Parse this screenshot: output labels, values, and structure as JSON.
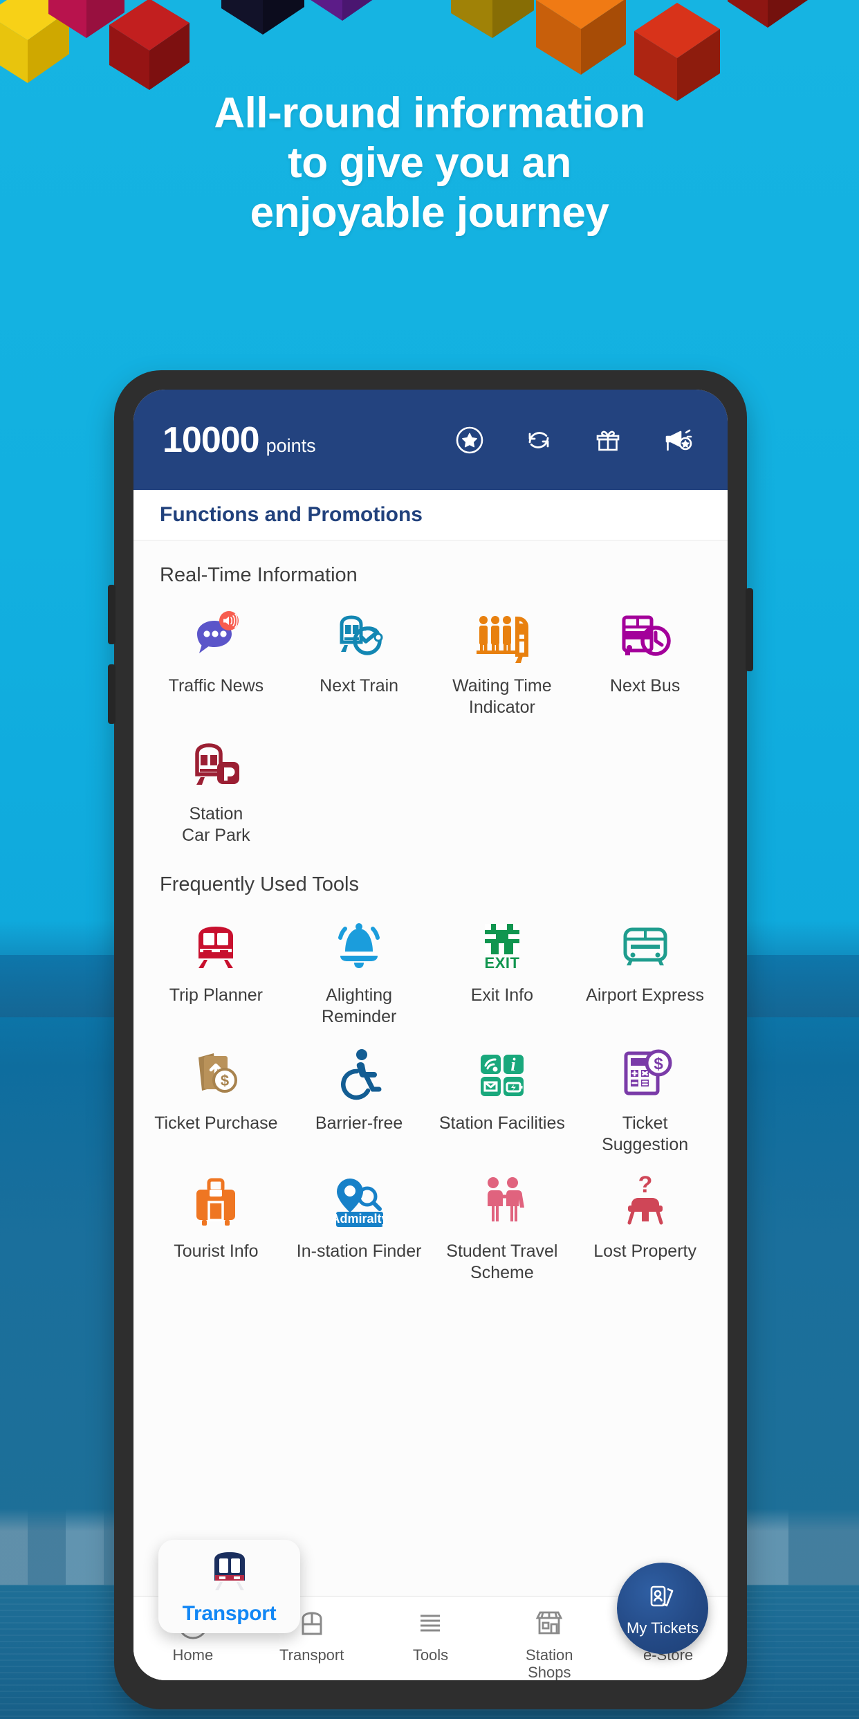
{
  "headline": {
    "line1": "All-round information",
    "line2": "to give you an",
    "line3": "enjoyable journey"
  },
  "colors": {
    "background_sky": "#16b4e2",
    "background_water": "#1d6c95",
    "app_header": "#23437f",
    "title_accent": "#21417c",
    "transport_active": "#1287f5",
    "my_tickets_bg": "#244a86"
  },
  "app_header": {
    "points_value": "10000",
    "points_label": "points",
    "icons": [
      {
        "name": "star-circle-icon",
        "label": "Rewards"
      },
      {
        "name": "refresh-icon",
        "label": "Refresh"
      },
      {
        "name": "gift-icon",
        "label": "Gifts"
      },
      {
        "name": "megaphone-star-icon",
        "label": "Announcements"
      }
    ]
  },
  "page_title": "Functions and Promotions",
  "sections": [
    {
      "title": "Real-Time Information",
      "items": [
        {
          "label": "Traffic News",
          "icon": "traffic-news-icon",
          "color": "#5b55c9"
        },
        {
          "label": "Next Train",
          "icon": "next-train-icon",
          "color": "#1387b3"
        },
        {
          "label": "Waiting Time\nIndicator",
          "icon": "waiting-time-icon",
          "color": "#e8800f"
        },
        {
          "label": "Next Bus",
          "icon": "next-bus-icon",
          "color": "#a3009a"
        },
        {
          "label": "Station\nCar Park",
          "icon": "station-car-park-icon",
          "color": "#9b1f33"
        }
      ]
    },
    {
      "title": "Frequently Used Tools",
      "items": [
        {
          "label": "Trip Planner",
          "icon": "trip-planner-icon",
          "color": "#c8102e"
        },
        {
          "label": "Alighting\nReminder",
          "icon": "alighting-reminder-icon",
          "color": "#1b9ddc"
        },
        {
          "label": "Exit Info",
          "icon": "exit-info-icon",
          "color": "#10954f"
        },
        {
          "label": "Airport Express",
          "icon": "airport-express-icon",
          "color": "#1f9d8e"
        },
        {
          "label": "Ticket Purchase",
          "icon": "ticket-purchase-icon",
          "color": "#a8834e"
        },
        {
          "label": "Barrier-free",
          "icon": "barrier-free-icon",
          "color": "#135d93"
        },
        {
          "label": "Station Facilities",
          "icon": "station-facilities-icon",
          "color": "#19a87c"
        },
        {
          "label": "Ticket\nSuggestion",
          "icon": "ticket-suggestion-icon",
          "color": "#7a3ba8"
        },
        {
          "label": "Tourist Info",
          "icon": "tourist-info-icon",
          "color": "#ef7622"
        },
        {
          "label": "In-station Finder",
          "icon": "in-station-finder-icon",
          "color": "#1781c8",
          "badge": "Admiralty"
        },
        {
          "label": "Student Travel\nScheme",
          "icon": "student-travel-icon",
          "color": "#e0637e"
        },
        {
          "label": "Lost Property",
          "icon": "lost-property-icon",
          "color": "#cf4657"
        }
      ]
    }
  ],
  "bottom_nav": {
    "items": [
      {
        "label": "Home",
        "icon": "mtr-logo-icon"
      },
      {
        "label": "Transport",
        "icon": "train-front-icon"
      },
      {
        "label": "Tools",
        "icon": "tools-icon"
      },
      {
        "label": "Station\nShops",
        "icon": "shop-icon"
      },
      {
        "label": "e-Store",
        "icon": "cart-icon"
      }
    ],
    "active_label": "Transport",
    "floating_button": {
      "label": "My Tickets",
      "icon": "tickets-icon"
    }
  }
}
